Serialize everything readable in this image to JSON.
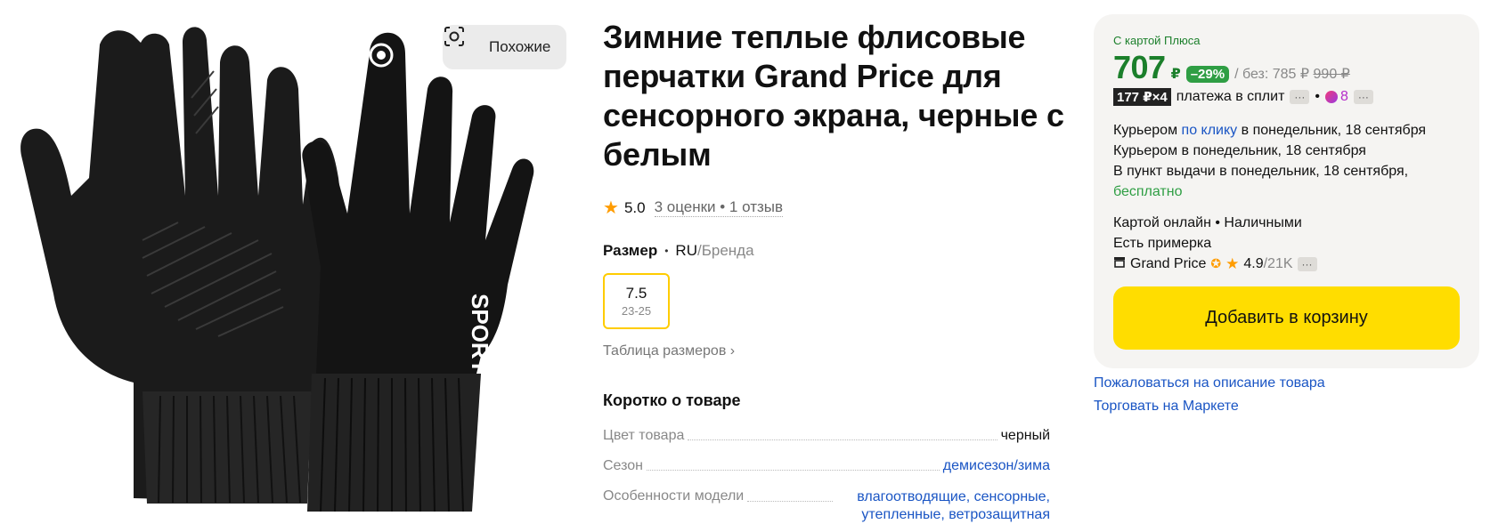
{
  "gallery": {
    "similar_label": "Похожие",
    "similar_icon": "visual-search-icon",
    "glove_text": "SPORT"
  },
  "product": {
    "title": "Зимние теплые флисовые перчатки Grand Price для сенсорного экрана, черные с белым",
    "rating": "5.0",
    "reviews": "3 оценки • 1 отзыв",
    "size_label": "Размер",
    "size_sep": "•",
    "size_system": "RU",
    "size_alt": "/Бренда",
    "size_value": "7.5",
    "size_range": "23-25",
    "size_table": "Таблица размеров ›",
    "short_title": "Коротко о товаре",
    "specs": [
      {
        "key": "Цвет товара",
        "value": "черный"
      },
      {
        "key": "Сезон",
        "value": "демисезон/зима"
      },
      {
        "key": "Особенности модели",
        "value": "влагоотводящие, сенсорные, утепленные, ветрозащитная"
      }
    ]
  },
  "offer": {
    "plus_label": "С картой Плюса",
    "price": "707",
    "currency": "₽",
    "discount": "–29%",
    "without_prefix": "/ без:",
    "without_price": "785 ₽",
    "old_price": "990 ₽",
    "split_box": "177 ₽×4",
    "split_text": "платежа в сплит",
    "more": "···",
    "points": "8",
    "delivery_1_prefix": "Курьером",
    "delivery_1_link": "по клику",
    "delivery_1_suffix": "в понедельник, 18 сентября",
    "delivery_2": "Курьером в понедельник, 18 сентября",
    "delivery_3": "В пункт выдачи в понедельник, 18 сентября,",
    "delivery_3_free": "бесплатно",
    "payment": "Картой онлайн • Наличными",
    "fitting": "Есть примерка",
    "shop_name": "Grand Price",
    "shop_rating": "4.9",
    "shop_count": "/21K",
    "cart_button": "Добавить в корзину"
  },
  "links": {
    "complain": "Пожаловаться на описание товара",
    "sell": "Торговать на Маркете"
  },
  "colors": {
    "accent_yellow": "#ffdd00",
    "plus_green": "#1b7f2b",
    "link_blue": "#1a55c4",
    "star_orange": "#ff9c00"
  }
}
